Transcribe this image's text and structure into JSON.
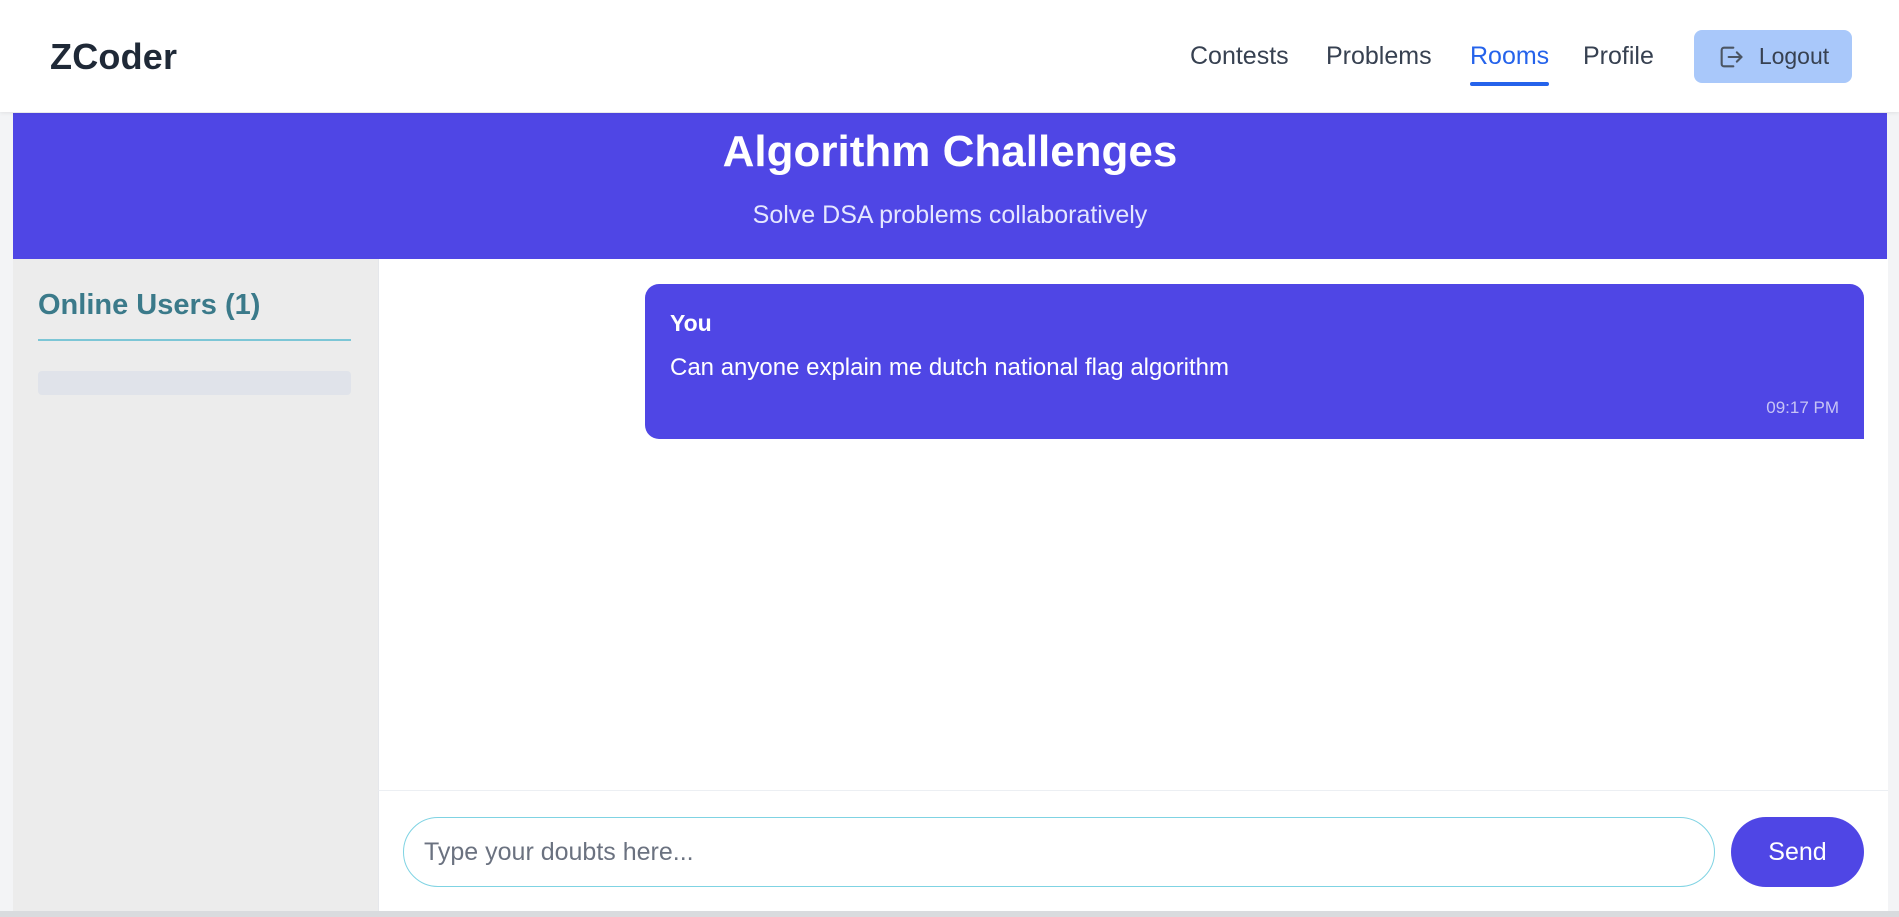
{
  "header": {
    "brand": "ZCoder",
    "nav": [
      {
        "label": "Contests",
        "active": false
      },
      {
        "label": "Problems",
        "active": false
      },
      {
        "label": "Rooms",
        "active": true
      },
      {
        "label": "Profile",
        "active": false
      }
    ],
    "logout_label": "Logout"
  },
  "room": {
    "title": "Algorithm Challenges",
    "subtitle": "Solve DSA problems collaboratively"
  },
  "sidebar": {
    "title": "Online Users (1)"
  },
  "messages": [
    {
      "sender": "You",
      "text": "Can anyone explain me dutch national flag algorithm",
      "time": "09:17 PM"
    }
  ],
  "composer": {
    "placeholder": "Type your doubts here...",
    "value": "",
    "send_label": "Send"
  },
  "colors": {
    "accent": "#4f46e5",
    "nav_active": "#2563eb",
    "logout_bg": "#a9c8fa",
    "sidebar_title": "#3b7a8a"
  },
  "icons": {
    "logout": "logout-icon"
  }
}
